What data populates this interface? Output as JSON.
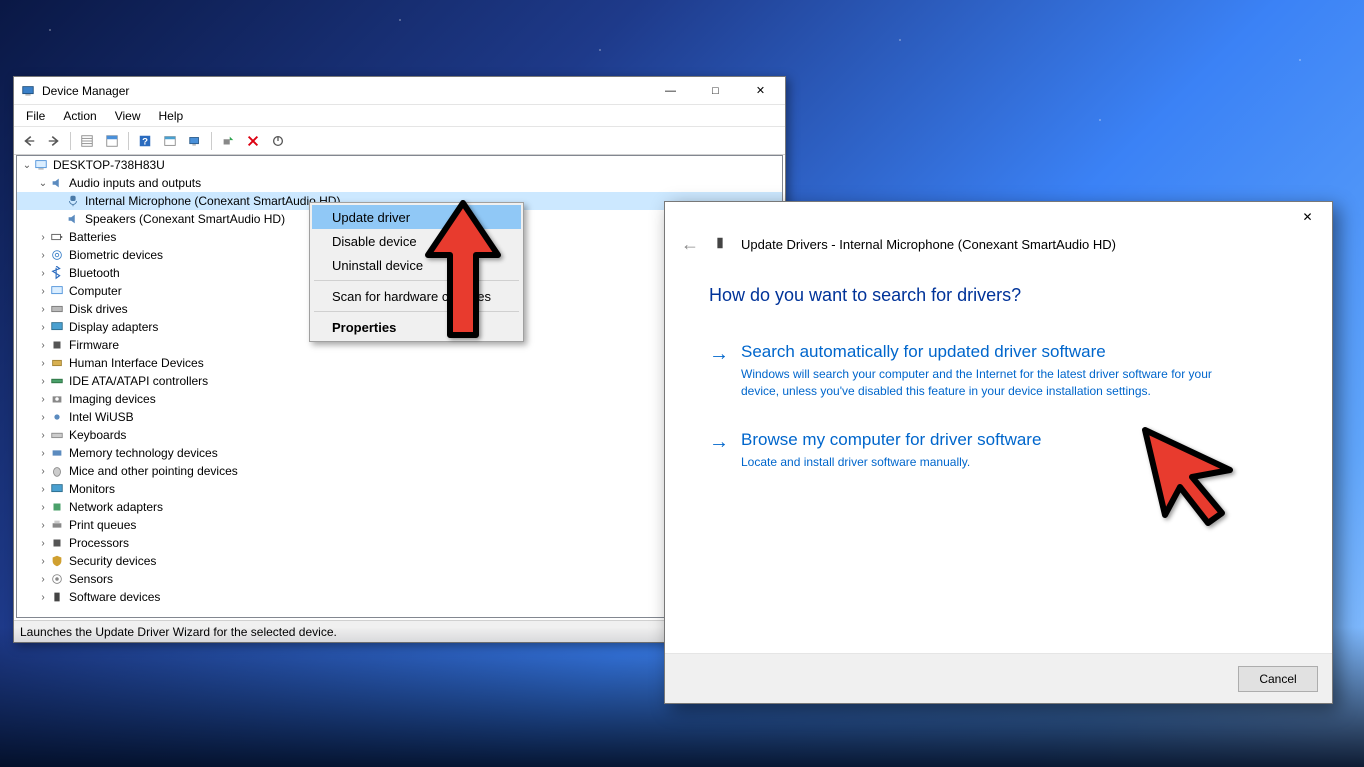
{
  "dm": {
    "title": "Device Manager",
    "menu": {
      "file": "File",
      "action": "Action",
      "view": "View",
      "help": "Help"
    },
    "status": "Launches the Update Driver Wizard for the selected device.",
    "root": "DESKTOP-738H83U",
    "audio": {
      "label": "Audio inputs and outputs",
      "mic": "Internal Microphone (Conexant SmartAudio HD)",
      "spk": "Speakers (Conexant SmartAudio HD)"
    },
    "nodes": {
      "batteries": "Batteries",
      "biometric": "Biometric devices",
      "bluetooth": "Bluetooth",
      "computer": "Computer",
      "disk": "Disk drives",
      "display": "Display adapters",
      "firmware": "Firmware",
      "hid": "Human Interface Devices",
      "ide": "IDE ATA/ATAPI controllers",
      "imaging": "Imaging devices",
      "wiusb": "Intel WiUSB",
      "keyboards": "Keyboards",
      "memtech": "Memory technology devices",
      "mice": "Mice and other pointing devices",
      "monitors": "Monitors",
      "network": "Network adapters",
      "printq": "Print queues",
      "processors": "Processors",
      "security": "Security devices",
      "sensors": "Sensors",
      "software": "Software devices"
    }
  },
  "ctx": {
    "update": "Update driver",
    "disable": "Disable device",
    "uninstall": "Uninstall device",
    "scan": "Scan for hardware changes",
    "properties": "Properties"
  },
  "ud": {
    "title": "Update Drivers - Internal Microphone (Conexant SmartAudio HD)",
    "heading": "How do you want to search for drivers?",
    "opt1_title": "Search automatically for updated driver software",
    "opt1_desc": "Windows will search your computer and the Internet for the latest driver software for your device, unless you've disabled this feature in your device installation settings.",
    "opt2_title": "Browse my computer for driver software",
    "opt2_desc": "Locate and install driver software manually.",
    "cancel": "Cancel"
  }
}
